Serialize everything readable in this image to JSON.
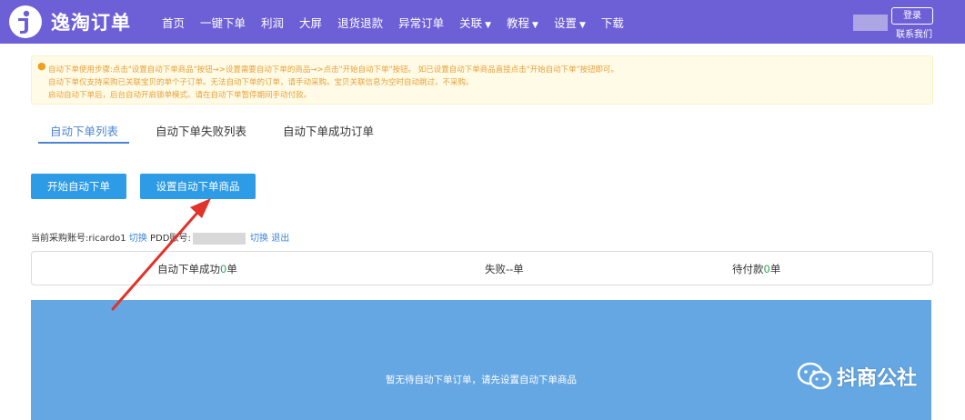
{
  "app": {
    "brand": "逸淘订单"
  },
  "nav": {
    "items": [
      {
        "label": "首页"
      },
      {
        "label": "一键下单"
      },
      {
        "label": "利润"
      },
      {
        "label": "大屏"
      },
      {
        "label": "退货退款"
      },
      {
        "label": "异常订单"
      },
      {
        "label": "关联",
        "dropdown": true
      },
      {
        "label": "教程",
        "dropdown": true
      },
      {
        "label": "设置",
        "dropdown": true
      },
      {
        "label": "下载"
      }
    ],
    "login_label": "登录",
    "contact_label": "联系我们"
  },
  "notice": {
    "lines": [
      "自动下单使用步骤:点击\"设置自动下单商品\"按钮→>设置需要自动下单的商品→>点击\"开始自动下单\"按钮。 如已设置自动下单商品直接点击\"开始自动下单\"按钮即可。",
      "自动下单仅支持采购已关联宝贝的单个子订单。无法自动下单的订单，请手动采购。宝贝关联信息为空时自动跳过，不采购。",
      "启动自动下单后，后台自动开启锁单模式。请在自动下单暂停期间手动付款。"
    ]
  },
  "tabs": [
    {
      "label": "自动下单列表",
      "active": true
    },
    {
      "label": "自动下单失败列表",
      "active": false
    },
    {
      "label": "自动下单成功订单",
      "active": false
    }
  ],
  "buttons": {
    "start": "开始自动下单",
    "configure": "设置自动下单商品"
  },
  "account": {
    "purchase_label": "当前采购账号:ricardo1",
    "switch1": "切换",
    "pdd_label": "PDD账号:",
    "switch2": "切换",
    "logout": "退出"
  },
  "stats": {
    "success_prefix": "自动下单成功",
    "success_value": "0",
    "success_suffix": "单",
    "fail_text": "失败--单",
    "pending_prefix": "待付款",
    "pending_value": "0",
    "pending_suffix": "单"
  },
  "empty_message": "暂无待自动下单订单，请先设置自动下单商品",
  "watermark": {
    "text": "抖商公社",
    "icon": "wechat-icon"
  },
  "colors": {
    "topbar": "#6d5fd6",
    "button": "#2d9be6",
    "panel": "#65a7e3",
    "accent": "#4c84d4",
    "arrow": "#e0332c",
    "success_num": "#2ca65a"
  }
}
